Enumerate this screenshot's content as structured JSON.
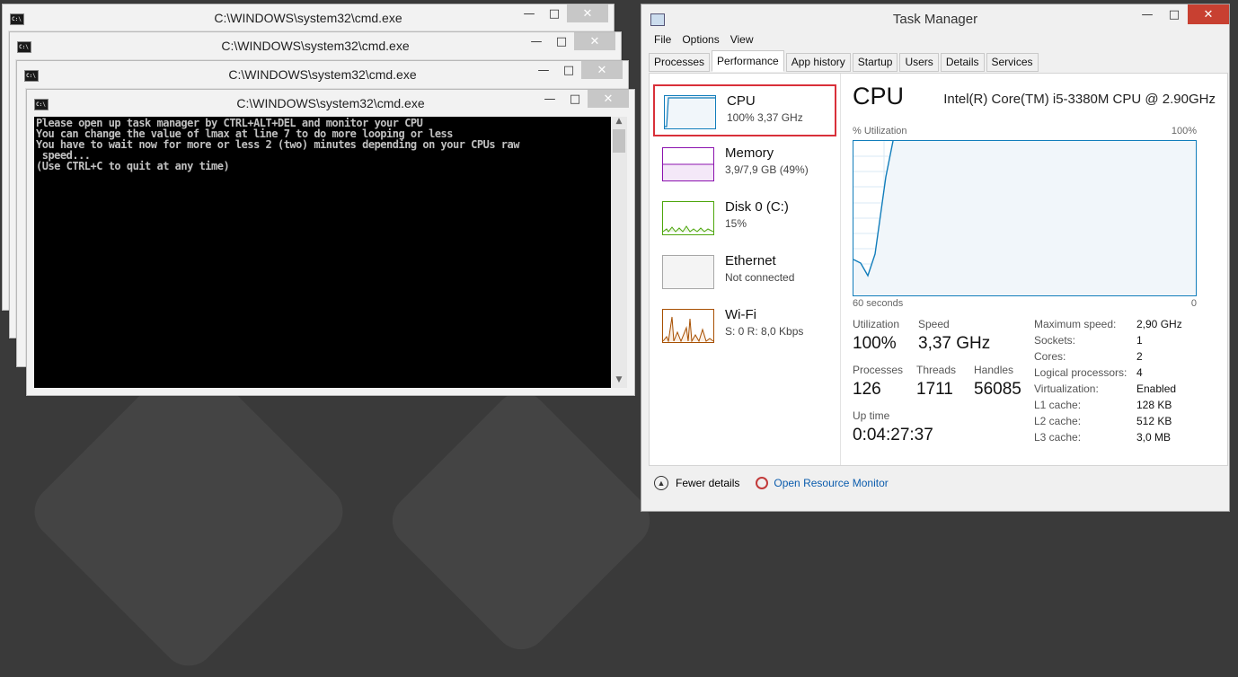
{
  "cmd_windows": [
    {
      "title": "C:\\WINDOWS\\system32\\cmd.exe"
    },
    {
      "title": "C:\\WINDOWS\\system32\\cmd.exe"
    },
    {
      "title": "C:\\WINDOWS\\system32\\cmd.exe"
    },
    {
      "title": "C:\\WINDOWS\\system32\\cmd.exe"
    }
  ],
  "cmd_icon_text": "C:\\",
  "console_lines": [
    "Please open up task manager by CTRL+ALT+DEL and monitor your CPU",
    "You can change the value of lmax at line 7 to do more looping or less",
    "You have to wait now for more or less 2 (two) minutes depending on your CPUs raw",
    " speed...",
    "(Use CTRL+C to quit at any time)"
  ],
  "window_controls": {
    "minimize": "—",
    "maximize": "□",
    "close": "✕"
  },
  "task_manager": {
    "title": "Task Manager",
    "menu": [
      "File",
      "Options",
      "View"
    ],
    "tabs": [
      "Processes",
      "Performance",
      "App history",
      "Startup",
      "Users",
      "Details",
      "Services"
    ],
    "active_tab": "Performance",
    "resources": [
      {
        "name": "CPU",
        "value": "100%  3,37 GHz",
        "color": "#117dbb",
        "selected": true
      },
      {
        "name": "Memory",
        "value": "3,9/7,9 GB (49%)",
        "color": "#8b12ae",
        "selected": false
      },
      {
        "name": "Disk 0 (C:)",
        "value": "15%",
        "color": "#4da60c",
        "selected": false
      },
      {
        "name": "Ethernet",
        "value": "Not connected",
        "color": "#a7a7a7",
        "selected": false
      },
      {
        "name": "Wi-Fi",
        "value": "S: 0  R: 8,0 Kbps",
        "color": "#a74f01",
        "selected": false
      }
    ],
    "cpu": {
      "heading": "CPU",
      "model": "Intel(R) Core(TM) i5-3380M CPU @ 2.90GHz",
      "graph_label": "% Utilization",
      "graph_max": "100%",
      "graph_time": "60 seconds",
      "graph_zero": "0",
      "utilization_label": "Utilization",
      "utilization": "100%",
      "speed_label": "Speed",
      "speed": "3,37 GHz",
      "processes_label": "Processes",
      "processes": "126",
      "threads_label": "Threads",
      "threads": "1711",
      "handles_label": "Handles",
      "handles": "56085",
      "uptime_label": "Up time",
      "uptime": "0:04:27:37",
      "details": [
        {
          "key": "Maximum speed:",
          "value": "2,90 GHz"
        },
        {
          "key": "Sockets:",
          "value": "1"
        },
        {
          "key": "Cores:",
          "value": "2"
        },
        {
          "key": "Logical processors:",
          "value": "4"
        },
        {
          "key": "Virtualization:",
          "value": "Enabled"
        },
        {
          "key": "L1 cache:",
          "value": "128 KB"
        },
        {
          "key": "L2 cache:",
          "value": "512 KB"
        },
        {
          "key": "L3 cache:",
          "value": "3,0 MB"
        }
      ]
    },
    "footer": {
      "fewer_details": "Fewer details",
      "resource_monitor": "Open Resource Monitor"
    }
  }
}
